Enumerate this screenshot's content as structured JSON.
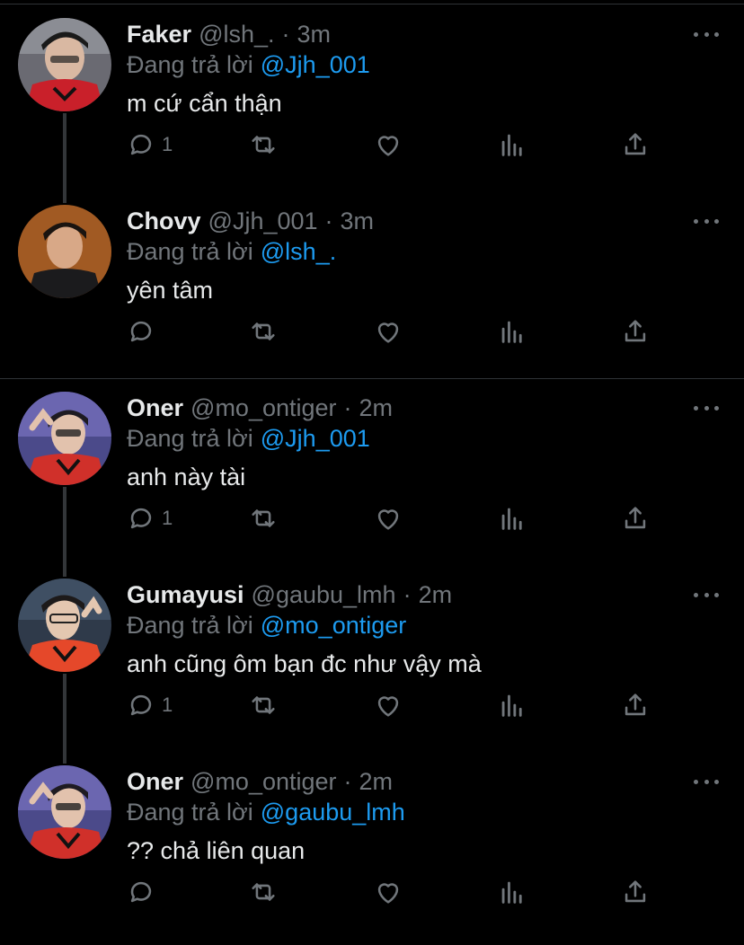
{
  "theme": {
    "background": "#000000",
    "text": "#e7e9ea",
    "muted": "#71767b",
    "mention": "#1d9bf0",
    "divider": "#2f3336"
  },
  "tweets": [
    {
      "name": "Faker",
      "handle": "@lsh_.",
      "dot": "·",
      "time": "3m",
      "reply_label": "Đang trả lời",
      "reply_to": "@Jjh_001",
      "text": "m cứ cẩn thận",
      "reply_count": "1",
      "avatar": "faker-avatar"
    },
    {
      "name": "Chovy",
      "handle": "@Jjh_001",
      "dot": "·",
      "time": "3m",
      "reply_label": "Đang trả lời",
      "reply_to": "@lsh_.",
      "text": "yên tâm",
      "reply_count": "",
      "avatar": "chovy-avatar"
    },
    {
      "name": "Oner",
      "handle": "@mo_ontiger",
      "dot": "·",
      "time": "2m",
      "reply_label": "Đang trả lời",
      "reply_to": "@Jjh_001",
      "text": "anh này tài",
      "reply_count": "1",
      "avatar": "oner-avatar"
    },
    {
      "name": "Gumayusi",
      "handle": "@gaubu_lmh",
      "dot": "·",
      "time": "2m",
      "reply_label": "Đang trả lời",
      "reply_to": "@mo_ontiger",
      "text": "anh cũng ôm bạn đc như vậy mà",
      "reply_count": "1",
      "avatar": "gumayusi-avatar"
    },
    {
      "name": "Oner",
      "handle": "@mo_ontiger",
      "dot": "·",
      "time": "2m",
      "reply_label": "Đang trả lời",
      "reply_to": "@gaubu_lmh",
      "text": "?? chả liên quan",
      "reply_count": "",
      "avatar": "oner-avatar"
    }
  ],
  "icons": [
    "reply-icon",
    "retweet-icon",
    "like-icon",
    "views-icon",
    "share-icon",
    "more-icon"
  ]
}
